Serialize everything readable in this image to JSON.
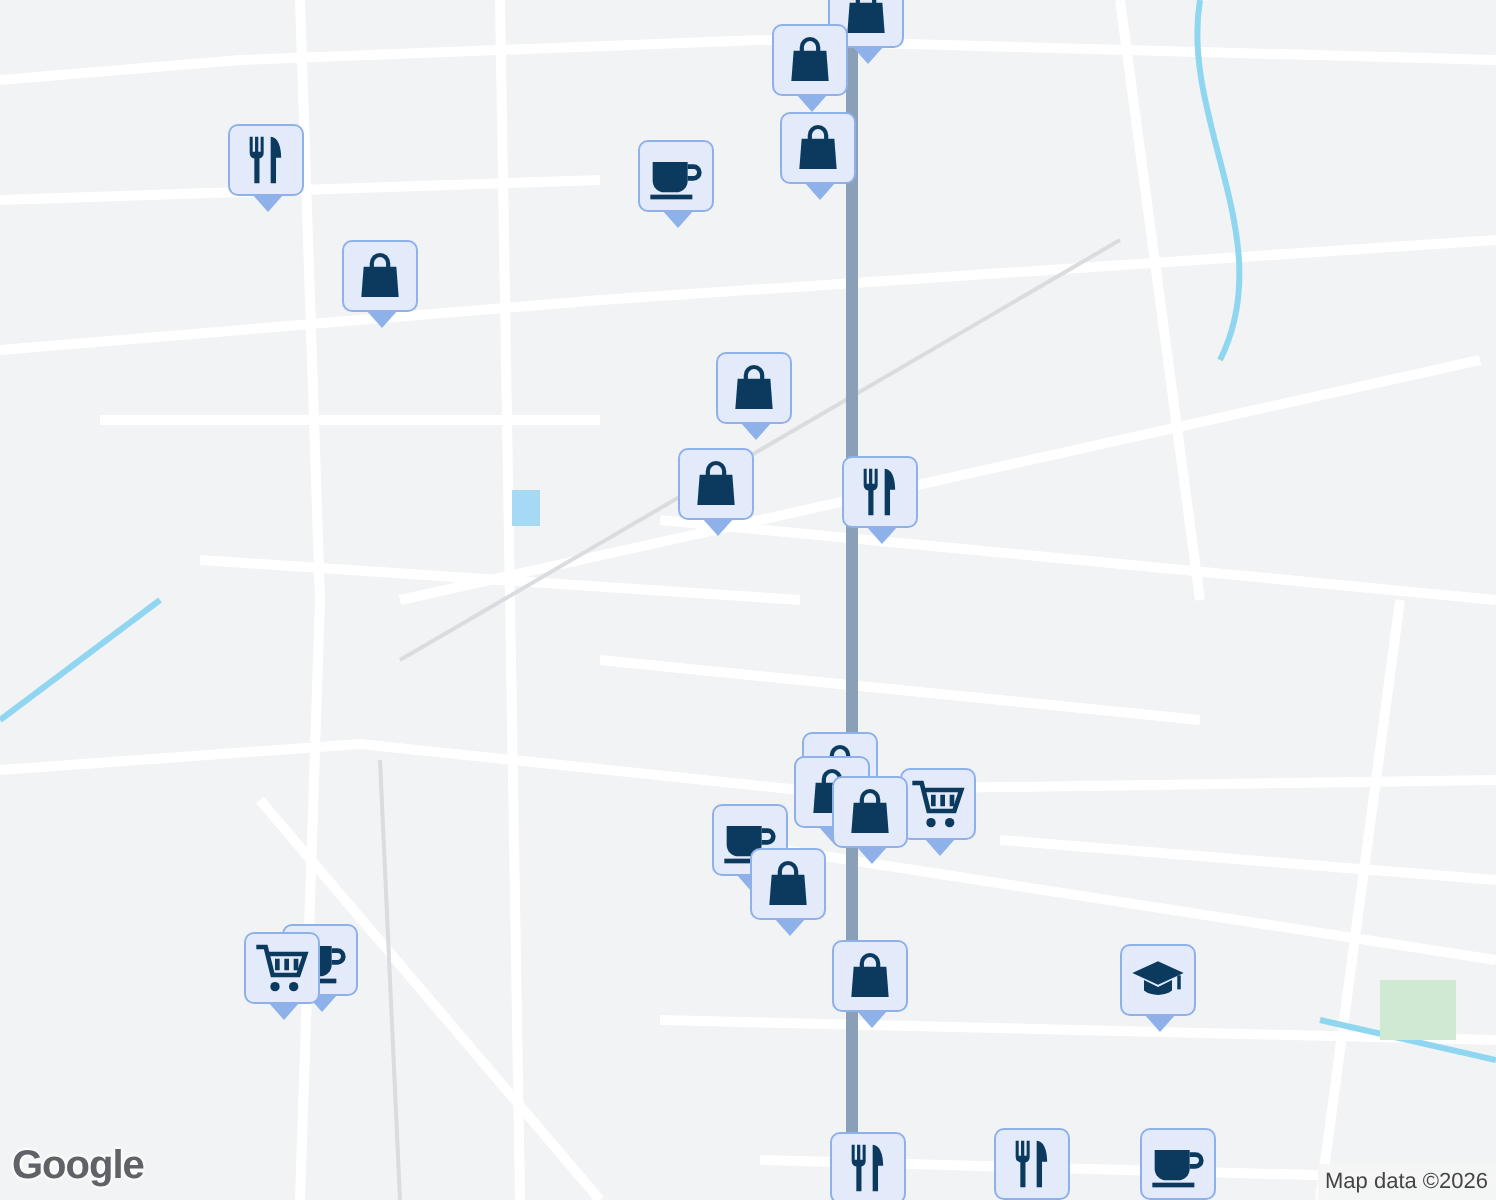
{
  "markers": [
    {
      "kind": "shopping"
    },
    {
      "kind": "shopping"
    },
    {
      "kind": "shopping"
    },
    {
      "kind": "cafe"
    },
    {
      "kind": "restaurant"
    },
    {
      "kind": "shopping"
    },
    {
      "kind": "shopping"
    },
    {
      "kind": "shopping"
    },
    {
      "kind": "restaurant"
    },
    {
      "kind": "shopping"
    },
    {
      "kind": "grocery"
    },
    {
      "kind": "shopping"
    },
    {
      "kind": "shopping"
    },
    {
      "kind": "cafe"
    },
    {
      "kind": "shopping"
    },
    {
      "kind": "shopping"
    },
    {
      "kind": "school"
    },
    {
      "kind": "cafe"
    },
    {
      "kind": "grocery"
    },
    {
      "kind": "restaurant"
    },
    {
      "kind": "restaurant"
    },
    {
      "kind": "cafe"
    }
  ],
  "logo": "Google",
  "attribution": "Map data ©2026"
}
